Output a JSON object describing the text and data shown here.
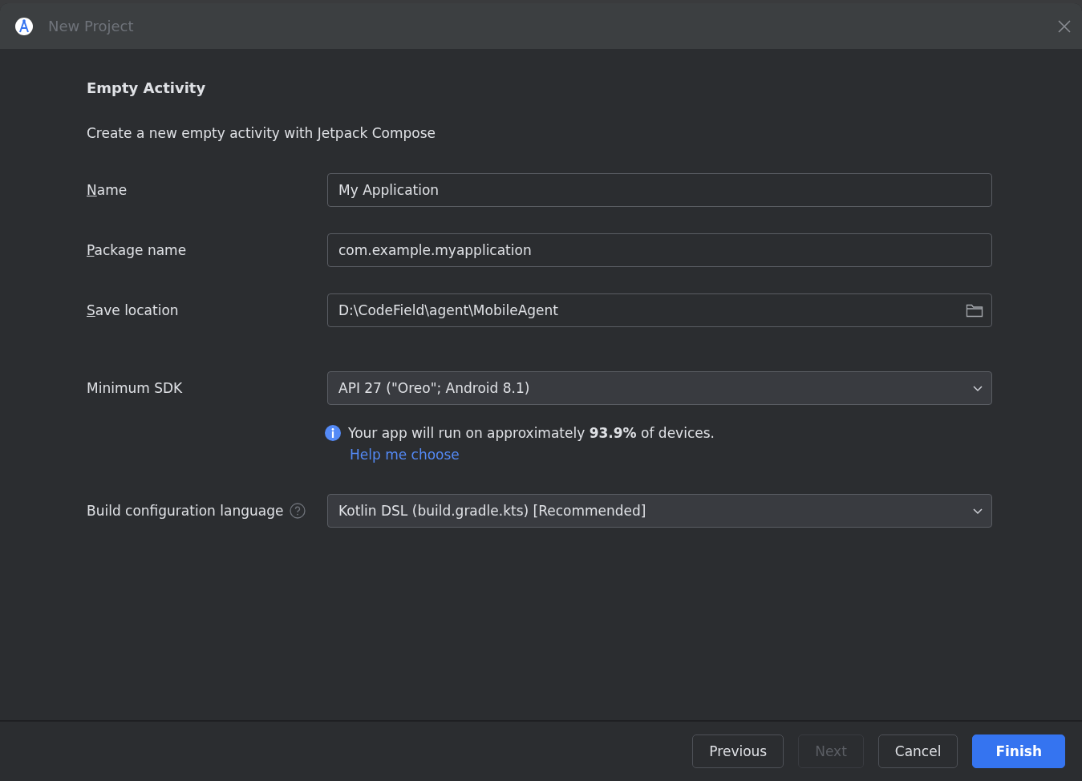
{
  "window": {
    "title": "New Project"
  },
  "heading": "Empty Activity",
  "description": "Create a new empty activity with Jetpack Compose",
  "fields": [
    {
      "label": "Name",
      "underline_first": true,
      "kind": "text",
      "value": "My Application"
    },
    {
      "label": "Package name",
      "underline_first": true,
      "kind": "text",
      "value": "com.example.myapplication"
    },
    {
      "label": "Save location",
      "underline_first": true,
      "kind": "path",
      "value": "D:\\CodeField\\agent\\MobileAgent"
    },
    {
      "label": "Minimum SDK",
      "underline_first": false,
      "kind": "dropdown",
      "value": "API 27 (\"Oreo\"; Android 8.1)",
      "note": "Your app will run on approximately **93.9%** of devices.",
      "link": "Help me choose"
    },
    {
      "label": "Build configuration language",
      "underline_first": false,
      "help": true,
      "kind": "dropdown",
      "value": "Kotlin DSL (build.gradle.kts) [Recommended]"
    }
  ],
  "buttons": [
    {
      "label": "Previous",
      "kind": "default",
      "disabled": false
    },
    {
      "label": "Next",
      "kind": "default",
      "disabled": true
    },
    {
      "label": "Cancel",
      "kind": "default",
      "disabled": false
    },
    {
      "label": "Finish",
      "kind": "primary",
      "disabled": false
    }
  ]
}
